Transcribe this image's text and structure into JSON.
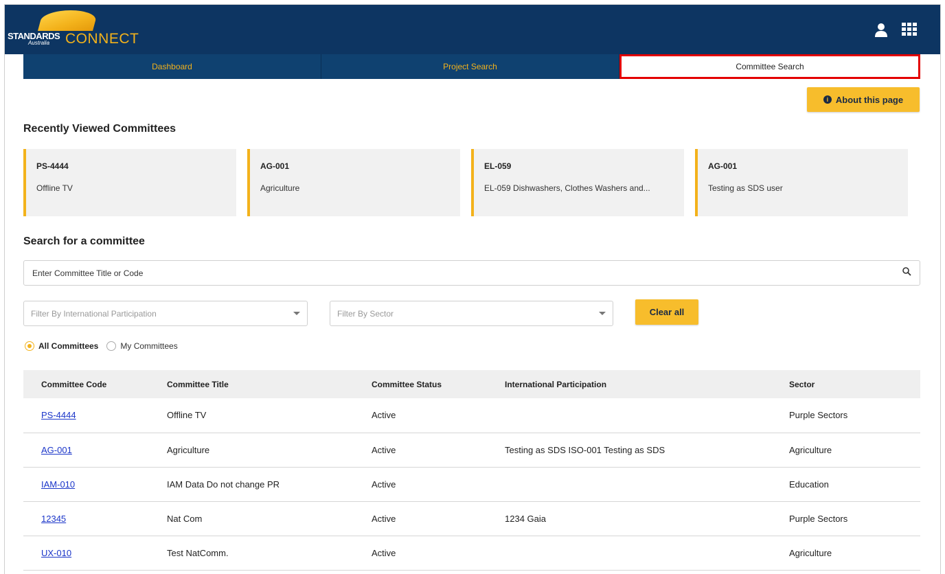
{
  "brand": {
    "standards": "STANDARDS",
    "australia": "Australia",
    "connect": "CONNECT"
  },
  "header": {
    "user_icon": "user-icon",
    "apps_icon": "apps-grid-icon"
  },
  "nav": {
    "tabs": [
      {
        "label": "Dashboard"
      },
      {
        "label": "Project Search"
      },
      {
        "label": "Committee Search"
      }
    ],
    "active": "Committee Search"
  },
  "about_button": {
    "label": "About this page",
    "icon": "info-icon"
  },
  "recent": {
    "title": "Recently Viewed Committees",
    "cards": [
      {
        "code": "PS-4444",
        "title": "Offline TV"
      },
      {
        "code": "AG-001",
        "title": "Agriculture"
      },
      {
        "code": "EL-059",
        "title": "EL-059 Dishwashers, Clothes Washers and..."
      },
      {
        "code": "AG-001",
        "title": "Testing as SDS user"
      }
    ]
  },
  "search": {
    "title": "Search for a committee",
    "placeholder": "Enter Committee Title or Code",
    "icon": "search-icon"
  },
  "filters": {
    "international_placeholder": "Filter By International Participation",
    "sector_placeholder": "Filter By Sector",
    "clear_label": "Clear all"
  },
  "scope": {
    "all_label": "All Committees",
    "mine_label": "My Committees",
    "selected": "All Committees"
  },
  "table": {
    "columns": [
      "Committee Code",
      "Committee Title",
      "Committee Status",
      "International Participation",
      "Sector"
    ],
    "rows": [
      {
        "code": "PS-4444",
        "title": "Offline TV",
        "status": "Active",
        "international": "",
        "sector": "Purple Sectors"
      },
      {
        "code": "AG-001",
        "title": "Agriculture",
        "status": "Active",
        "international": "Testing as SDS ISO-001 Testing as SDS",
        "sector": "Agriculture"
      },
      {
        "code": "IAM-010",
        "title": "IAM Data Do not change PR",
        "status": "Active",
        "international": "",
        "sector": "Education"
      },
      {
        "code": "12345",
        "title": "Nat Com",
        "status": "Active",
        "international": "1234 Gaia",
        "sector": "Purple Sectors"
      },
      {
        "code": "UX-010",
        "title": "Test NatComm.",
        "status": "Active",
        "international": "",
        "sector": "Agriculture"
      }
    ]
  },
  "colors": {
    "header_bg": "#0d3562",
    "nav_bg": "#0f4170",
    "accent": "#f3b21b",
    "highlight": "#e30000",
    "link": "#1a35c9"
  }
}
